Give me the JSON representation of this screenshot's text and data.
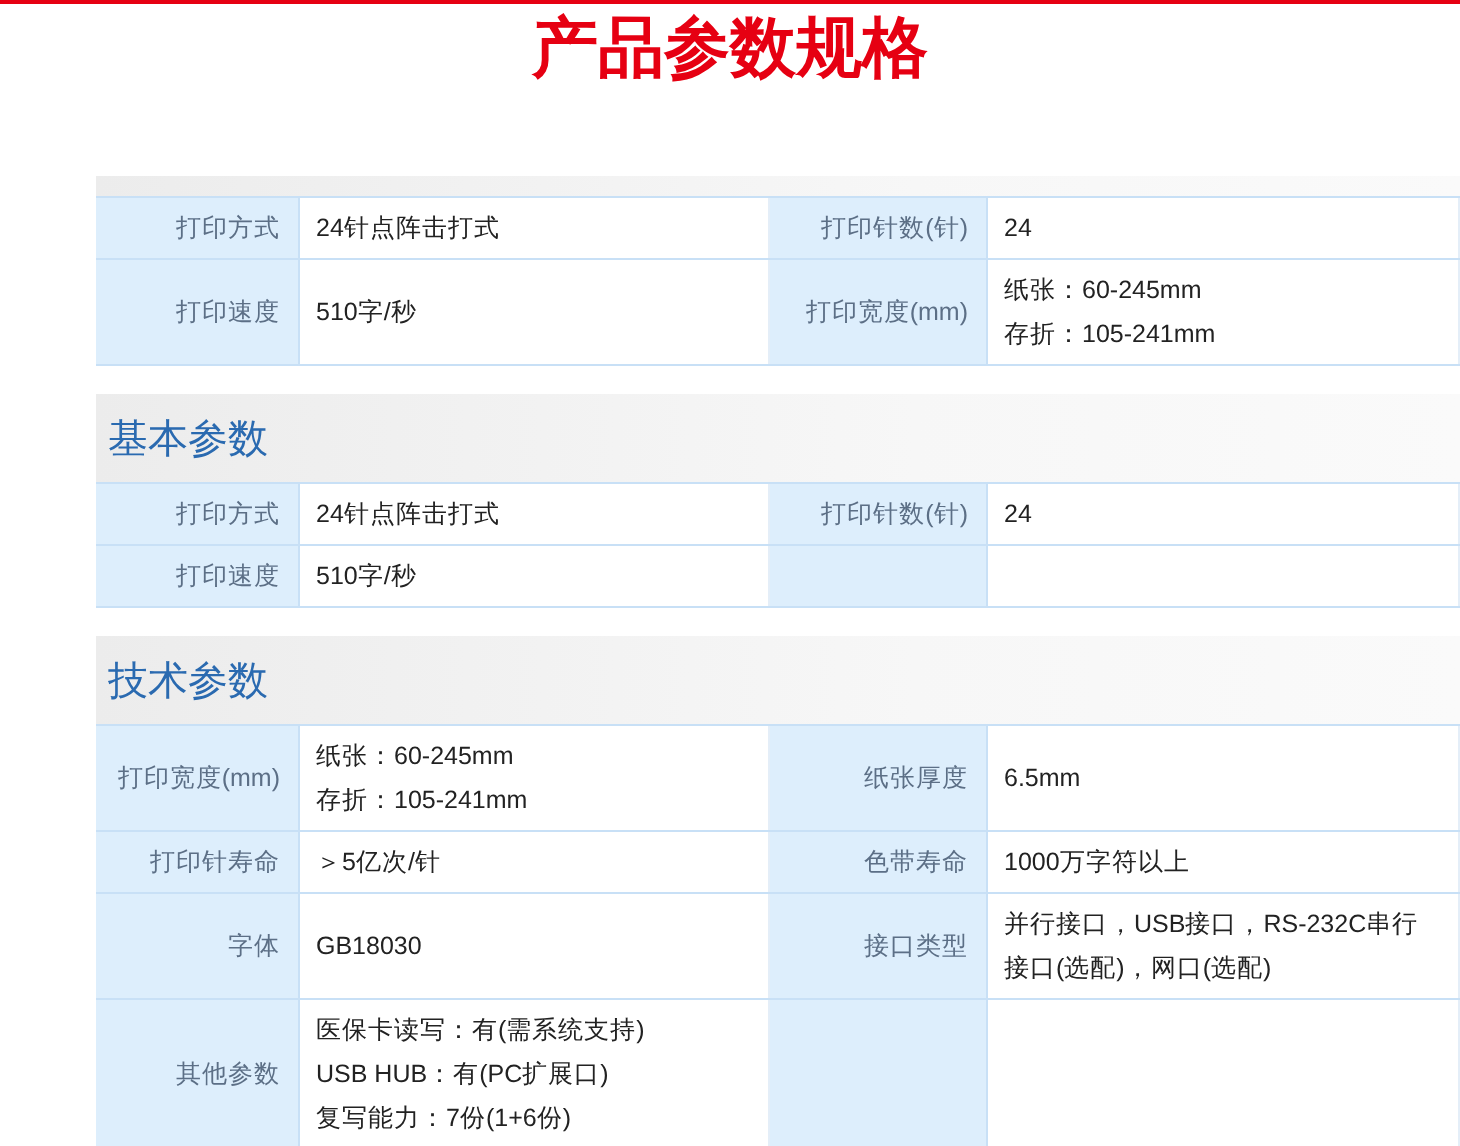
{
  "title": "产品参数规格",
  "sections": [
    {
      "rows": [
        {
          "left": {
            "label": "打印方式",
            "lines": [
              "24针点阵击打式"
            ]
          },
          "right": {
            "label": "打印针数(针)",
            "lines": [
              "24"
            ]
          }
        },
        {
          "left": {
            "label": "打印速度",
            "lines": [
              "510字/秒"
            ]
          },
          "right": {
            "label": "打印宽度(mm)",
            "lines": [
              "纸张：60-245mm",
              "存折：105-241mm"
            ]
          }
        }
      ]
    },
    {
      "heading": "基本参数",
      "rows": [
        {
          "left": {
            "label": "打印方式",
            "lines": [
              "24针点阵击打式"
            ]
          },
          "right": {
            "label": "打印针数(针)",
            "lines": [
              "24"
            ]
          }
        },
        {
          "left": {
            "label": "打印速度",
            "lines": [
              "510字/秒"
            ]
          }
        }
      ]
    },
    {
      "heading": "技术参数",
      "rows": [
        {
          "left": {
            "label": "打印宽度(mm)",
            "lines": [
              "纸张：60-245mm",
              "存折：105-241mm"
            ]
          },
          "right": {
            "label": "纸张厚度",
            "lines": [
              "6.5mm"
            ]
          }
        },
        {
          "left": {
            "label": "打印针寿命",
            "lines": [
              "＞5亿次/针"
            ]
          },
          "right": {
            "label": "色带寿命",
            "lines": [
              "1000万字符以上"
            ]
          }
        },
        {
          "left": {
            "label": "字体",
            "lines": [
              "GB18030"
            ]
          },
          "right": {
            "label": "接口类型",
            "lines": [
              "并行接口，USB接口，RS-232C串行接口(选配)，网口(选配)"
            ]
          }
        },
        {
          "left": {
            "label": "其他参数",
            "lines": [
              "医保卡读写：有(需系统支持)",
              "USB HUB：有(PC扩展口)",
              "复写能力：7份(1+6份)"
            ]
          }
        }
      ]
    }
  ]
}
